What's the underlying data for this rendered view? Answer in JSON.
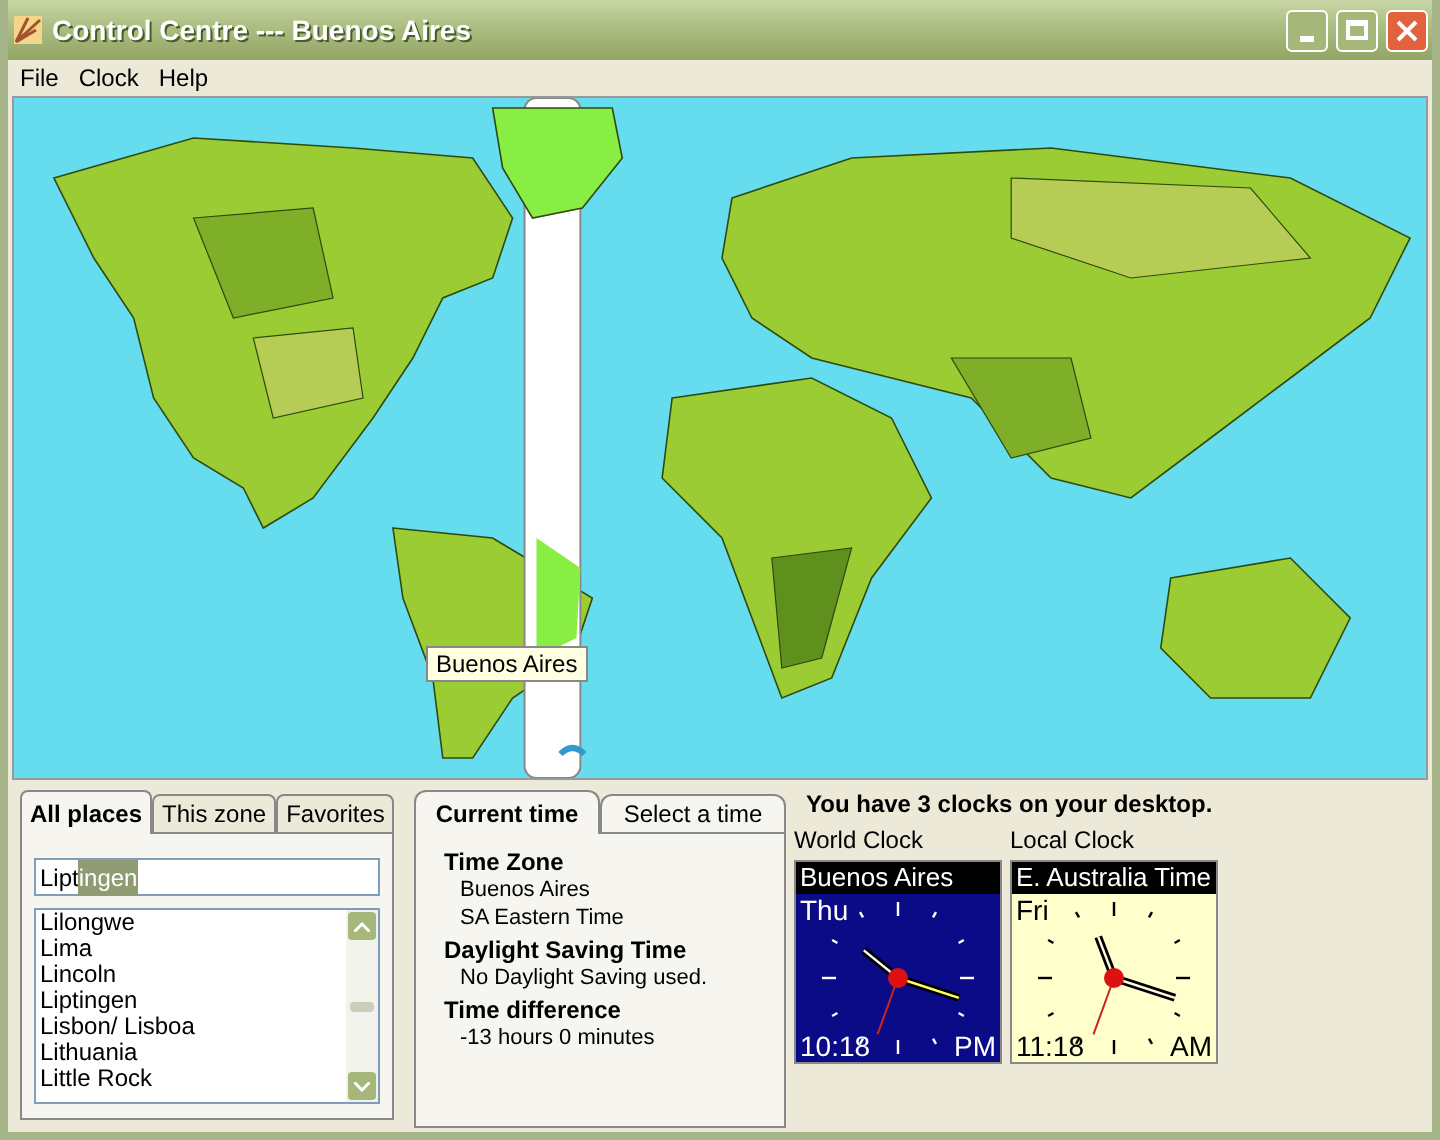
{
  "window": {
    "title": "Control Centre --- Buenos Aires"
  },
  "menu": [
    {
      "label": "File"
    },
    {
      "label": "Clock"
    },
    {
      "label": "Help"
    }
  ],
  "map": {
    "tooltip": "Buenos Aires"
  },
  "places_tabs": [
    {
      "label": "All places",
      "selected": true
    },
    {
      "label": "This zone",
      "selected": false
    },
    {
      "label": "Favorites",
      "selected": false
    }
  ],
  "search": {
    "typed": "Lipt",
    "completion": "ingen"
  },
  "places": [
    "Lilongwe",
    "Lima",
    "Lincoln",
    "Liptingen",
    "Lisbon/ Lisboa",
    "Lithuania",
    "Little Rock"
  ],
  "time_tabs": [
    {
      "label": "Current time",
      "selected": true
    },
    {
      "label": "Select a time",
      "selected": false
    }
  ],
  "current_time": [
    {
      "heading": "Time Zone",
      "lines": [
        "Buenos Aires",
        "SA Eastern Time"
      ]
    },
    {
      "heading": "Daylight Saving Time",
      "lines": [
        "No Daylight Saving used."
      ]
    },
    {
      "heading": "Time difference",
      "lines": [
        "-13 hours 0 minutes"
      ]
    }
  ],
  "clocks_message": "You have 3 clocks on your desktop.",
  "clocks": [
    {
      "label": "World Clock",
      "name": "Buenos Aires",
      "day": "Thu",
      "time": "10:18",
      "ampm": "PM",
      "kind": "dark"
    },
    {
      "label": "Local Clock",
      "name": "E. Australia Time",
      "day": "Fri",
      "time": "11:18",
      "ampm": "AM",
      "kind": "light"
    }
  ]
}
